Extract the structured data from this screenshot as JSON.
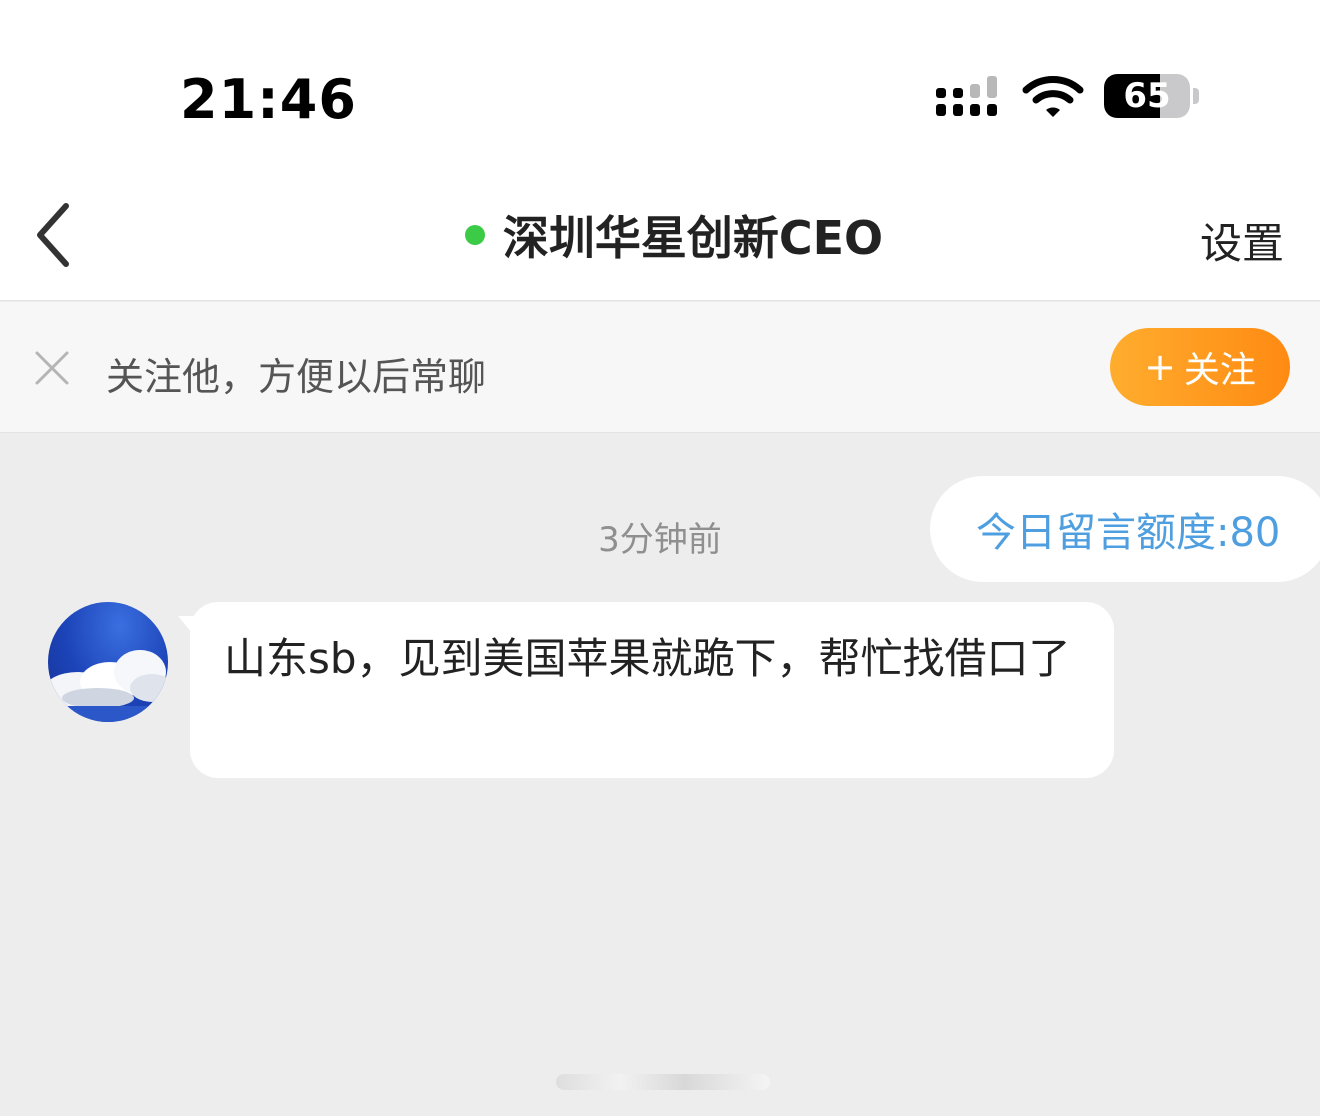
{
  "status_bar": {
    "time": "21:46",
    "battery_level": "65",
    "battery_fraction": 0.65,
    "signal_icon": "signal-icon",
    "wifi_icon": "wifi-icon",
    "battery_icon": "battery-icon"
  },
  "nav": {
    "back_icon": "chevron-left-icon",
    "title": "深圳华星创新CEO",
    "online_status_color": "#3ccb47",
    "settings_label": "设置"
  },
  "follow_banner": {
    "close_icon": "close-icon",
    "text": "关注他，方便以后常聊",
    "button_plus": "+",
    "button_label": "关注",
    "button_color": "#ff9a1f"
  },
  "chat": {
    "timestamp": "3分钟前",
    "quota_text": "今日留言额度:80",
    "quota_color": "#4f9fe0",
    "messages": [
      {
        "text": "山东sb，见到美国苹果就跪下，帮忙找借口了"
      }
    ]
  }
}
